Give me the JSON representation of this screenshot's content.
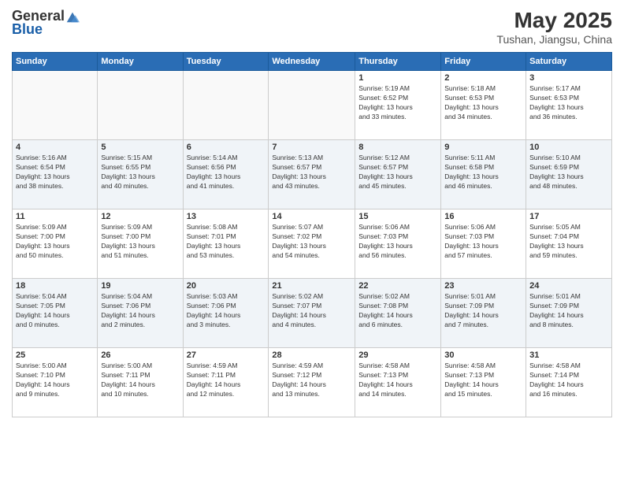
{
  "header": {
    "logo_line1": "General",
    "logo_line2": "Blue",
    "month_year": "May 2025",
    "location": "Tushan, Jiangsu, China"
  },
  "days_of_week": [
    "Sunday",
    "Monday",
    "Tuesday",
    "Wednesday",
    "Thursday",
    "Friday",
    "Saturday"
  ],
  "weeks": [
    [
      {
        "day": "",
        "info": ""
      },
      {
        "day": "",
        "info": ""
      },
      {
        "day": "",
        "info": ""
      },
      {
        "day": "",
        "info": ""
      },
      {
        "day": "1",
        "info": "Sunrise: 5:19 AM\nSunset: 6:52 PM\nDaylight: 13 hours\nand 33 minutes."
      },
      {
        "day": "2",
        "info": "Sunrise: 5:18 AM\nSunset: 6:53 PM\nDaylight: 13 hours\nand 34 minutes."
      },
      {
        "day": "3",
        "info": "Sunrise: 5:17 AM\nSunset: 6:53 PM\nDaylight: 13 hours\nand 36 minutes."
      }
    ],
    [
      {
        "day": "4",
        "info": "Sunrise: 5:16 AM\nSunset: 6:54 PM\nDaylight: 13 hours\nand 38 minutes."
      },
      {
        "day": "5",
        "info": "Sunrise: 5:15 AM\nSunset: 6:55 PM\nDaylight: 13 hours\nand 40 minutes."
      },
      {
        "day": "6",
        "info": "Sunrise: 5:14 AM\nSunset: 6:56 PM\nDaylight: 13 hours\nand 41 minutes."
      },
      {
        "day": "7",
        "info": "Sunrise: 5:13 AM\nSunset: 6:57 PM\nDaylight: 13 hours\nand 43 minutes."
      },
      {
        "day": "8",
        "info": "Sunrise: 5:12 AM\nSunset: 6:57 PM\nDaylight: 13 hours\nand 45 minutes."
      },
      {
        "day": "9",
        "info": "Sunrise: 5:11 AM\nSunset: 6:58 PM\nDaylight: 13 hours\nand 46 minutes."
      },
      {
        "day": "10",
        "info": "Sunrise: 5:10 AM\nSunset: 6:59 PM\nDaylight: 13 hours\nand 48 minutes."
      }
    ],
    [
      {
        "day": "11",
        "info": "Sunrise: 5:09 AM\nSunset: 7:00 PM\nDaylight: 13 hours\nand 50 minutes."
      },
      {
        "day": "12",
        "info": "Sunrise: 5:09 AM\nSunset: 7:00 PM\nDaylight: 13 hours\nand 51 minutes."
      },
      {
        "day": "13",
        "info": "Sunrise: 5:08 AM\nSunset: 7:01 PM\nDaylight: 13 hours\nand 53 minutes."
      },
      {
        "day": "14",
        "info": "Sunrise: 5:07 AM\nSunset: 7:02 PM\nDaylight: 13 hours\nand 54 minutes."
      },
      {
        "day": "15",
        "info": "Sunrise: 5:06 AM\nSunset: 7:03 PM\nDaylight: 13 hours\nand 56 minutes."
      },
      {
        "day": "16",
        "info": "Sunrise: 5:06 AM\nSunset: 7:03 PM\nDaylight: 13 hours\nand 57 minutes."
      },
      {
        "day": "17",
        "info": "Sunrise: 5:05 AM\nSunset: 7:04 PM\nDaylight: 13 hours\nand 59 minutes."
      }
    ],
    [
      {
        "day": "18",
        "info": "Sunrise: 5:04 AM\nSunset: 7:05 PM\nDaylight: 14 hours\nand 0 minutes."
      },
      {
        "day": "19",
        "info": "Sunrise: 5:04 AM\nSunset: 7:06 PM\nDaylight: 14 hours\nand 2 minutes."
      },
      {
        "day": "20",
        "info": "Sunrise: 5:03 AM\nSunset: 7:06 PM\nDaylight: 14 hours\nand 3 minutes."
      },
      {
        "day": "21",
        "info": "Sunrise: 5:02 AM\nSunset: 7:07 PM\nDaylight: 14 hours\nand 4 minutes."
      },
      {
        "day": "22",
        "info": "Sunrise: 5:02 AM\nSunset: 7:08 PM\nDaylight: 14 hours\nand 6 minutes."
      },
      {
        "day": "23",
        "info": "Sunrise: 5:01 AM\nSunset: 7:09 PM\nDaylight: 14 hours\nand 7 minutes."
      },
      {
        "day": "24",
        "info": "Sunrise: 5:01 AM\nSunset: 7:09 PM\nDaylight: 14 hours\nand 8 minutes."
      }
    ],
    [
      {
        "day": "25",
        "info": "Sunrise: 5:00 AM\nSunset: 7:10 PM\nDaylight: 14 hours\nand 9 minutes."
      },
      {
        "day": "26",
        "info": "Sunrise: 5:00 AM\nSunset: 7:11 PM\nDaylight: 14 hours\nand 10 minutes."
      },
      {
        "day": "27",
        "info": "Sunrise: 4:59 AM\nSunset: 7:11 PM\nDaylight: 14 hours\nand 12 minutes."
      },
      {
        "day": "28",
        "info": "Sunrise: 4:59 AM\nSunset: 7:12 PM\nDaylight: 14 hours\nand 13 minutes."
      },
      {
        "day": "29",
        "info": "Sunrise: 4:58 AM\nSunset: 7:13 PM\nDaylight: 14 hours\nand 14 minutes."
      },
      {
        "day": "30",
        "info": "Sunrise: 4:58 AM\nSunset: 7:13 PM\nDaylight: 14 hours\nand 15 minutes."
      },
      {
        "day": "31",
        "info": "Sunrise: 4:58 AM\nSunset: 7:14 PM\nDaylight: 14 hours\nand 16 minutes."
      }
    ]
  ]
}
